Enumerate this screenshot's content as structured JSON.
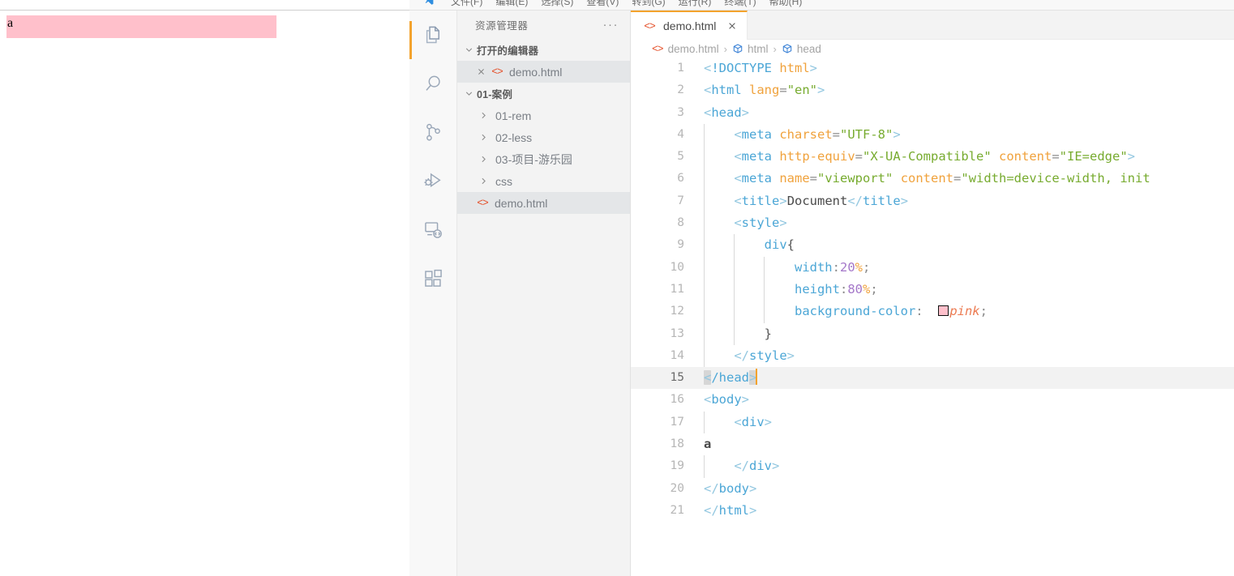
{
  "browser_preview": {
    "div_text": "a",
    "div_background_color": "#ffc0cb"
  },
  "menubar": {
    "logo_icon": "vscode-logo-icon",
    "items": [
      "文件(F)",
      "编辑(E)",
      "选择(S)",
      "查看(V)",
      "转到(G)",
      "运行(R)",
      "终端(T)",
      "帮助(H)"
    ]
  },
  "activity_bar": {
    "active_item": "explorer",
    "accent_color": "#f3a32d",
    "items": [
      {
        "name": "explorer-icon",
        "label": "资源管理器"
      },
      {
        "name": "search-icon",
        "label": "搜索"
      },
      {
        "name": "source-control-icon",
        "label": "源代码管理"
      },
      {
        "name": "run-and-debug-icon",
        "label": "运行和调试"
      },
      {
        "name": "remote-explorer-icon",
        "label": "远程资源管理器"
      },
      {
        "name": "extensions-icon",
        "label": "扩展"
      }
    ]
  },
  "sidebar": {
    "title": "资源管理器",
    "more_actions": "···",
    "sections": [
      {
        "label": "打开的编辑器",
        "expanded": true,
        "items": [
          {
            "label": "demo.html",
            "icon": "html5-icon",
            "closable": true,
            "selected": true
          }
        ]
      },
      {
        "label": "01-案例",
        "expanded": true,
        "items": [
          {
            "label": "01-rem",
            "type": "folder",
            "expanded": false
          },
          {
            "label": "02-less",
            "type": "folder",
            "expanded": false
          },
          {
            "label": "03-项目-游乐园",
            "type": "folder",
            "expanded": false
          },
          {
            "label": "css",
            "type": "folder",
            "expanded": false
          },
          {
            "label": "demo.html",
            "type": "file",
            "icon": "html5-icon",
            "selected": true
          }
        ]
      }
    ]
  },
  "editor": {
    "tab": {
      "label": "demo.html",
      "icon": "html5-icon",
      "close_icon": "close-icon",
      "active": true,
      "accent_color": "#f3a32d"
    },
    "breadcrumb": [
      {
        "label": "demo.html",
        "icon": "html5-icon"
      },
      {
        "label": "html",
        "icon": "symbol-cube-icon"
      },
      {
        "label": "head",
        "icon": "symbol-cube-icon"
      }
    ],
    "active_line": 15,
    "cursor_color": "#f3a32d",
    "total_lines": 21,
    "color_swatch": {
      "line": 12,
      "color": "#ffc0cb",
      "value_text": "pink"
    },
    "lines": [
      {
        "n": 1,
        "text": "<!DOCTYPE html>"
      },
      {
        "n": 2,
        "text": "<html lang=\"en\">"
      },
      {
        "n": 3,
        "text": "<head>"
      },
      {
        "n": 4,
        "text": "    <meta charset=\"UTF-8\">"
      },
      {
        "n": 5,
        "text": "    <meta http-equiv=\"X-UA-Compatible\" content=\"IE=edge\">"
      },
      {
        "n": 6,
        "text": "    <meta name=\"viewport\" content=\"width=device-width, init"
      },
      {
        "n": 7,
        "text": "    <title>Document</title>"
      },
      {
        "n": 8,
        "text": "    <style>"
      },
      {
        "n": 9,
        "text": "        div{"
      },
      {
        "n": 10,
        "text": "            width:20%;"
      },
      {
        "n": 11,
        "text": "            height:80%;"
      },
      {
        "n": 12,
        "text": "            background-color:  pink;"
      },
      {
        "n": 13,
        "text": "        }"
      },
      {
        "n": 14,
        "text": "    </style>"
      },
      {
        "n": 15,
        "text": "</head>"
      },
      {
        "n": 16,
        "text": "<body>"
      },
      {
        "n": 17,
        "text": "    <div>"
      },
      {
        "n": 18,
        "text": "a"
      },
      {
        "n": 19,
        "text": "    </div>"
      },
      {
        "n": 20,
        "text": "</body>"
      },
      {
        "n": 21,
        "text": "</html>"
      }
    ]
  }
}
